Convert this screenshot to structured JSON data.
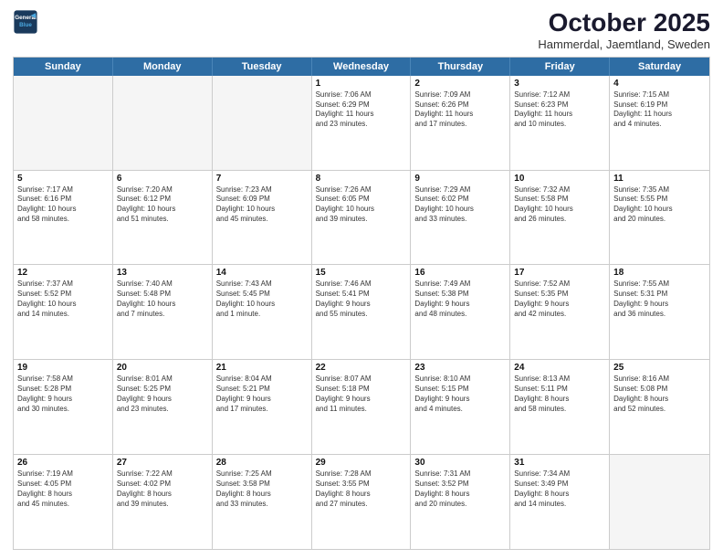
{
  "header": {
    "logo_line1": "General",
    "logo_line2": "Blue",
    "month": "October 2025",
    "location": "Hammerdal, Jaemtland, Sweden"
  },
  "weekdays": [
    "Sunday",
    "Monday",
    "Tuesday",
    "Wednesday",
    "Thursday",
    "Friday",
    "Saturday"
  ],
  "rows": [
    [
      {
        "day": "",
        "text": ""
      },
      {
        "day": "",
        "text": ""
      },
      {
        "day": "",
        "text": ""
      },
      {
        "day": "1",
        "text": "Sunrise: 7:06 AM\nSunset: 6:29 PM\nDaylight: 11 hours\nand 23 minutes."
      },
      {
        "day": "2",
        "text": "Sunrise: 7:09 AM\nSunset: 6:26 PM\nDaylight: 11 hours\nand 17 minutes."
      },
      {
        "day": "3",
        "text": "Sunrise: 7:12 AM\nSunset: 6:23 PM\nDaylight: 11 hours\nand 10 minutes."
      },
      {
        "day": "4",
        "text": "Sunrise: 7:15 AM\nSunset: 6:19 PM\nDaylight: 11 hours\nand 4 minutes."
      }
    ],
    [
      {
        "day": "5",
        "text": "Sunrise: 7:17 AM\nSunset: 6:16 PM\nDaylight: 10 hours\nand 58 minutes."
      },
      {
        "day": "6",
        "text": "Sunrise: 7:20 AM\nSunset: 6:12 PM\nDaylight: 10 hours\nand 51 minutes."
      },
      {
        "day": "7",
        "text": "Sunrise: 7:23 AM\nSunset: 6:09 PM\nDaylight: 10 hours\nand 45 minutes."
      },
      {
        "day": "8",
        "text": "Sunrise: 7:26 AM\nSunset: 6:05 PM\nDaylight: 10 hours\nand 39 minutes."
      },
      {
        "day": "9",
        "text": "Sunrise: 7:29 AM\nSunset: 6:02 PM\nDaylight: 10 hours\nand 33 minutes."
      },
      {
        "day": "10",
        "text": "Sunrise: 7:32 AM\nSunset: 5:58 PM\nDaylight: 10 hours\nand 26 minutes."
      },
      {
        "day": "11",
        "text": "Sunrise: 7:35 AM\nSunset: 5:55 PM\nDaylight: 10 hours\nand 20 minutes."
      }
    ],
    [
      {
        "day": "12",
        "text": "Sunrise: 7:37 AM\nSunset: 5:52 PM\nDaylight: 10 hours\nand 14 minutes."
      },
      {
        "day": "13",
        "text": "Sunrise: 7:40 AM\nSunset: 5:48 PM\nDaylight: 10 hours\nand 7 minutes."
      },
      {
        "day": "14",
        "text": "Sunrise: 7:43 AM\nSunset: 5:45 PM\nDaylight: 10 hours\nand 1 minute."
      },
      {
        "day": "15",
        "text": "Sunrise: 7:46 AM\nSunset: 5:41 PM\nDaylight: 9 hours\nand 55 minutes."
      },
      {
        "day": "16",
        "text": "Sunrise: 7:49 AM\nSunset: 5:38 PM\nDaylight: 9 hours\nand 48 minutes."
      },
      {
        "day": "17",
        "text": "Sunrise: 7:52 AM\nSunset: 5:35 PM\nDaylight: 9 hours\nand 42 minutes."
      },
      {
        "day": "18",
        "text": "Sunrise: 7:55 AM\nSunset: 5:31 PM\nDaylight: 9 hours\nand 36 minutes."
      }
    ],
    [
      {
        "day": "19",
        "text": "Sunrise: 7:58 AM\nSunset: 5:28 PM\nDaylight: 9 hours\nand 30 minutes."
      },
      {
        "day": "20",
        "text": "Sunrise: 8:01 AM\nSunset: 5:25 PM\nDaylight: 9 hours\nand 23 minutes."
      },
      {
        "day": "21",
        "text": "Sunrise: 8:04 AM\nSunset: 5:21 PM\nDaylight: 9 hours\nand 17 minutes."
      },
      {
        "day": "22",
        "text": "Sunrise: 8:07 AM\nSunset: 5:18 PM\nDaylight: 9 hours\nand 11 minutes."
      },
      {
        "day": "23",
        "text": "Sunrise: 8:10 AM\nSunset: 5:15 PM\nDaylight: 9 hours\nand 4 minutes."
      },
      {
        "day": "24",
        "text": "Sunrise: 8:13 AM\nSunset: 5:11 PM\nDaylight: 8 hours\nand 58 minutes."
      },
      {
        "day": "25",
        "text": "Sunrise: 8:16 AM\nSunset: 5:08 PM\nDaylight: 8 hours\nand 52 minutes."
      }
    ],
    [
      {
        "day": "26",
        "text": "Sunrise: 7:19 AM\nSunset: 4:05 PM\nDaylight: 8 hours\nand 45 minutes."
      },
      {
        "day": "27",
        "text": "Sunrise: 7:22 AM\nSunset: 4:02 PM\nDaylight: 8 hours\nand 39 minutes."
      },
      {
        "day": "28",
        "text": "Sunrise: 7:25 AM\nSunset: 3:58 PM\nDaylight: 8 hours\nand 33 minutes."
      },
      {
        "day": "29",
        "text": "Sunrise: 7:28 AM\nSunset: 3:55 PM\nDaylight: 8 hours\nand 27 minutes."
      },
      {
        "day": "30",
        "text": "Sunrise: 7:31 AM\nSunset: 3:52 PM\nDaylight: 8 hours\nand 20 minutes."
      },
      {
        "day": "31",
        "text": "Sunrise: 7:34 AM\nSunset: 3:49 PM\nDaylight: 8 hours\nand 14 minutes."
      },
      {
        "day": "",
        "text": ""
      }
    ]
  ]
}
